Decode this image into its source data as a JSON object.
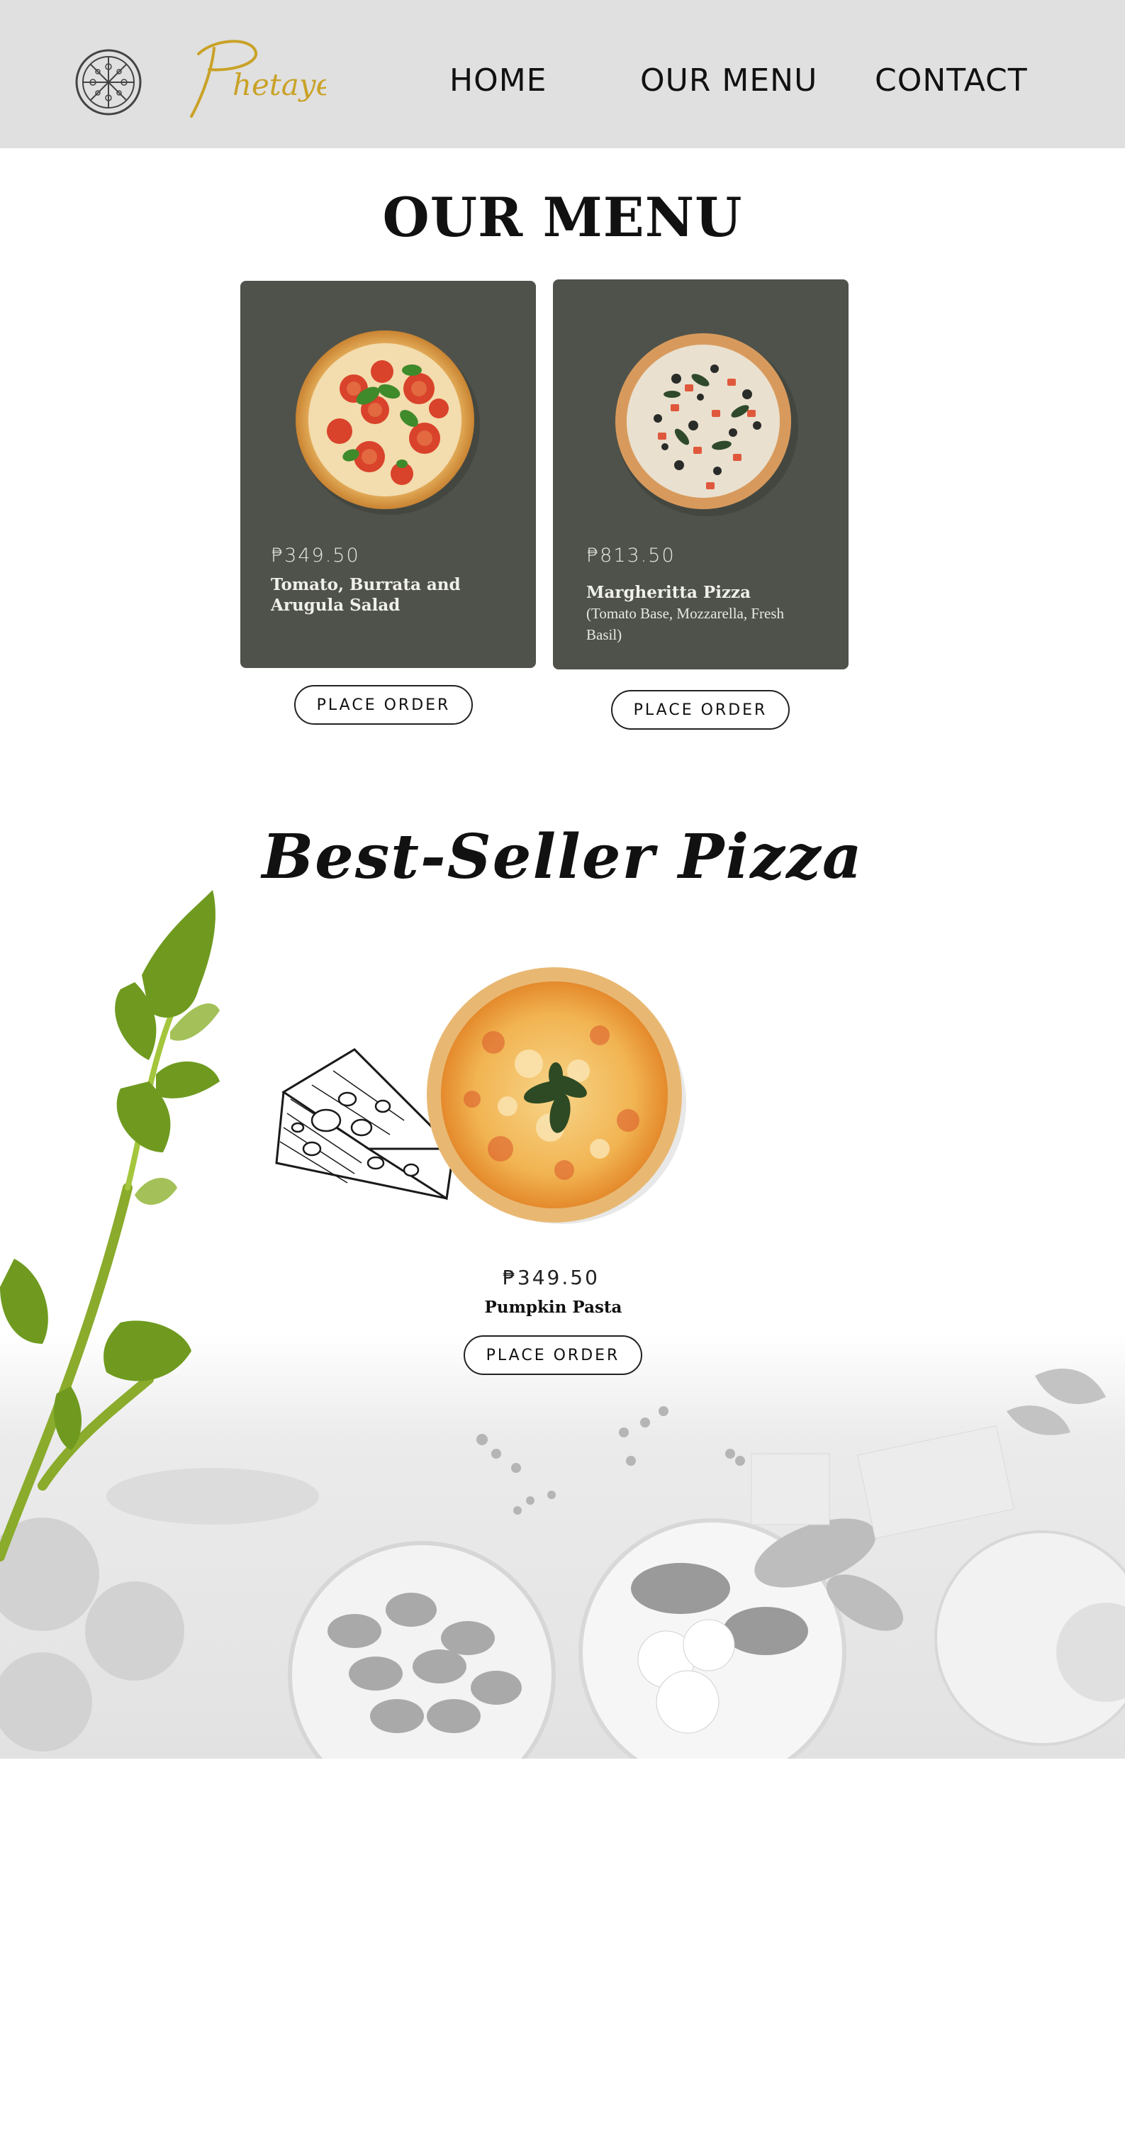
{
  "header": {
    "brand": "Phetayer",
    "nav": [
      {
        "label": "HOME"
      },
      {
        "label": "OUR MENU"
      },
      {
        "label": "CONTACT"
      }
    ]
  },
  "menu": {
    "title": "OUR MENU",
    "items": [
      {
        "price": "₱349.50",
        "name": "Tomato, Burrata and Arugula Salad",
        "description": "",
        "button": "PLACE ORDER"
      },
      {
        "price": "₱813.50",
        "name": "Margheritta Pizza",
        "description": "(Tomato Base, Mozzarella, Fresh Basil)",
        "button": "PLACE ORDER"
      }
    ]
  },
  "best_seller": {
    "title": "Best-Seller Pizza",
    "price": "₱349.50",
    "name": "Pumpkin Pasta",
    "button": "PLACE ORDER"
  },
  "colors": {
    "header_bg": "#e0e0e0",
    "card_bg": "#4f524b",
    "brand_gold": "#c9a227",
    "leaf_green": "#6f9a1f"
  },
  "icons": {
    "logo_mark": "pizza-slices-icon",
    "cheese": "cheese-illustration",
    "celery": "celery-leaves-illustration"
  }
}
